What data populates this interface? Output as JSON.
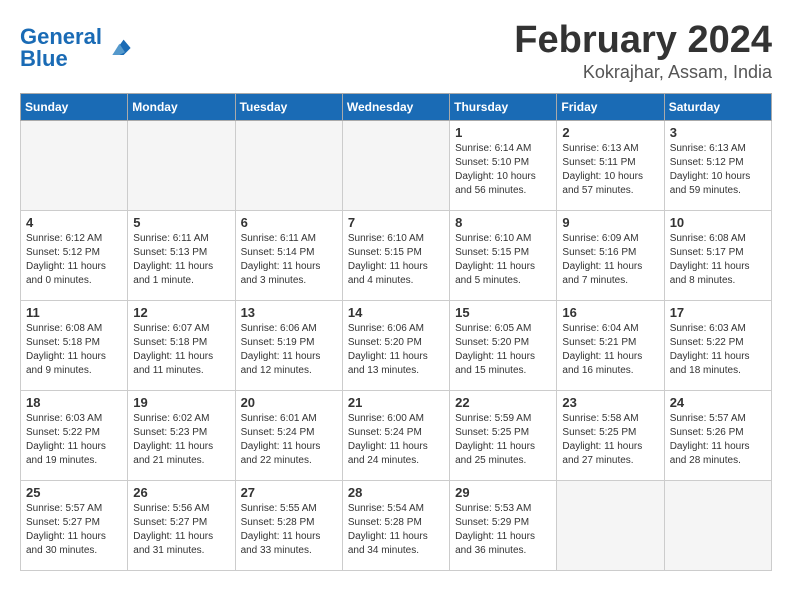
{
  "header": {
    "logo_general": "General",
    "logo_blue": "Blue",
    "month_year": "February 2024",
    "location": "Kokrajhar, Assam, India"
  },
  "weekdays": [
    "Sunday",
    "Monday",
    "Tuesday",
    "Wednesday",
    "Thursday",
    "Friday",
    "Saturday"
  ],
  "weeks": [
    [
      {
        "day": "",
        "info": ""
      },
      {
        "day": "",
        "info": ""
      },
      {
        "day": "",
        "info": ""
      },
      {
        "day": "",
        "info": ""
      },
      {
        "day": "1",
        "info": "Sunrise: 6:14 AM\nSunset: 5:10 PM\nDaylight: 10 hours\nand 56 minutes."
      },
      {
        "day": "2",
        "info": "Sunrise: 6:13 AM\nSunset: 5:11 PM\nDaylight: 10 hours\nand 57 minutes."
      },
      {
        "day": "3",
        "info": "Sunrise: 6:13 AM\nSunset: 5:12 PM\nDaylight: 10 hours\nand 59 minutes."
      }
    ],
    [
      {
        "day": "4",
        "info": "Sunrise: 6:12 AM\nSunset: 5:12 PM\nDaylight: 11 hours\nand 0 minutes."
      },
      {
        "day": "5",
        "info": "Sunrise: 6:11 AM\nSunset: 5:13 PM\nDaylight: 11 hours\nand 1 minute."
      },
      {
        "day": "6",
        "info": "Sunrise: 6:11 AM\nSunset: 5:14 PM\nDaylight: 11 hours\nand 3 minutes."
      },
      {
        "day": "7",
        "info": "Sunrise: 6:10 AM\nSunset: 5:15 PM\nDaylight: 11 hours\nand 4 minutes."
      },
      {
        "day": "8",
        "info": "Sunrise: 6:10 AM\nSunset: 5:15 PM\nDaylight: 11 hours\nand 5 minutes."
      },
      {
        "day": "9",
        "info": "Sunrise: 6:09 AM\nSunset: 5:16 PM\nDaylight: 11 hours\nand 7 minutes."
      },
      {
        "day": "10",
        "info": "Sunrise: 6:08 AM\nSunset: 5:17 PM\nDaylight: 11 hours\nand 8 minutes."
      }
    ],
    [
      {
        "day": "11",
        "info": "Sunrise: 6:08 AM\nSunset: 5:18 PM\nDaylight: 11 hours\nand 9 minutes."
      },
      {
        "day": "12",
        "info": "Sunrise: 6:07 AM\nSunset: 5:18 PM\nDaylight: 11 hours\nand 11 minutes."
      },
      {
        "day": "13",
        "info": "Sunrise: 6:06 AM\nSunset: 5:19 PM\nDaylight: 11 hours\nand 12 minutes."
      },
      {
        "day": "14",
        "info": "Sunrise: 6:06 AM\nSunset: 5:20 PM\nDaylight: 11 hours\nand 13 minutes."
      },
      {
        "day": "15",
        "info": "Sunrise: 6:05 AM\nSunset: 5:20 PM\nDaylight: 11 hours\nand 15 minutes."
      },
      {
        "day": "16",
        "info": "Sunrise: 6:04 AM\nSunset: 5:21 PM\nDaylight: 11 hours\nand 16 minutes."
      },
      {
        "day": "17",
        "info": "Sunrise: 6:03 AM\nSunset: 5:22 PM\nDaylight: 11 hours\nand 18 minutes."
      }
    ],
    [
      {
        "day": "18",
        "info": "Sunrise: 6:03 AM\nSunset: 5:22 PM\nDaylight: 11 hours\nand 19 minutes."
      },
      {
        "day": "19",
        "info": "Sunrise: 6:02 AM\nSunset: 5:23 PM\nDaylight: 11 hours\nand 21 minutes."
      },
      {
        "day": "20",
        "info": "Sunrise: 6:01 AM\nSunset: 5:24 PM\nDaylight: 11 hours\nand 22 minutes."
      },
      {
        "day": "21",
        "info": "Sunrise: 6:00 AM\nSunset: 5:24 PM\nDaylight: 11 hours\nand 24 minutes."
      },
      {
        "day": "22",
        "info": "Sunrise: 5:59 AM\nSunset: 5:25 PM\nDaylight: 11 hours\nand 25 minutes."
      },
      {
        "day": "23",
        "info": "Sunrise: 5:58 AM\nSunset: 5:25 PM\nDaylight: 11 hours\nand 27 minutes."
      },
      {
        "day": "24",
        "info": "Sunrise: 5:57 AM\nSunset: 5:26 PM\nDaylight: 11 hours\nand 28 minutes."
      }
    ],
    [
      {
        "day": "25",
        "info": "Sunrise: 5:57 AM\nSunset: 5:27 PM\nDaylight: 11 hours\nand 30 minutes."
      },
      {
        "day": "26",
        "info": "Sunrise: 5:56 AM\nSunset: 5:27 PM\nDaylight: 11 hours\nand 31 minutes."
      },
      {
        "day": "27",
        "info": "Sunrise: 5:55 AM\nSunset: 5:28 PM\nDaylight: 11 hours\nand 33 minutes."
      },
      {
        "day": "28",
        "info": "Sunrise: 5:54 AM\nSunset: 5:28 PM\nDaylight: 11 hours\nand 34 minutes."
      },
      {
        "day": "29",
        "info": "Sunrise: 5:53 AM\nSunset: 5:29 PM\nDaylight: 11 hours\nand 36 minutes."
      },
      {
        "day": "",
        "info": ""
      },
      {
        "day": "",
        "info": ""
      }
    ]
  ]
}
